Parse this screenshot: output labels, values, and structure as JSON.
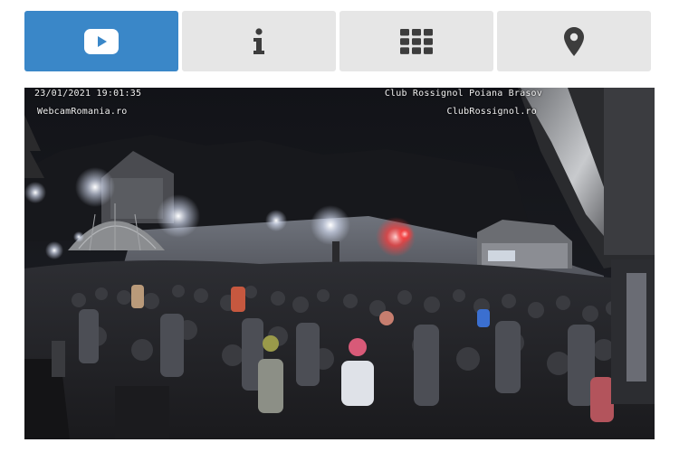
{
  "tabs": [
    {
      "id": "video",
      "icon": "play-icon",
      "active": true
    },
    {
      "id": "info",
      "icon": "info-icon",
      "active": false
    },
    {
      "id": "gallery",
      "icon": "grid-icon",
      "active": false
    },
    {
      "id": "map",
      "icon": "map-pin-icon",
      "active": false
    }
  ],
  "colors": {
    "active_tab": "#3a87c8",
    "inactive_tab": "#e6e6e6",
    "inactive_icon": "#3d3d3d"
  },
  "webcam": {
    "timestamp": "23/01/2021 19:01:35",
    "source": "WebcamRomania.ro",
    "location": "Club Rossignol Poiana Brasov",
    "brand": "ClubRossignol.ro"
  }
}
